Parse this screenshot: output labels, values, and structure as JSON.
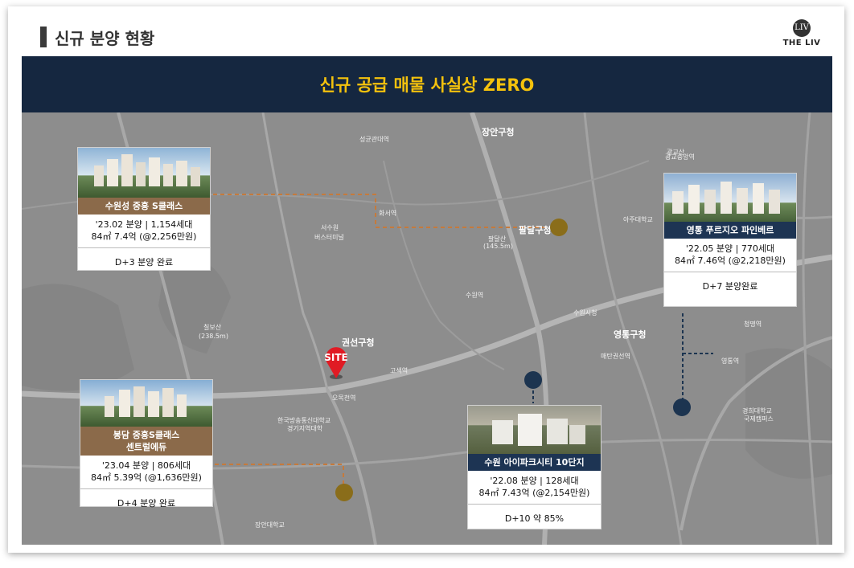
{
  "header": {
    "title": "신규 분양 현황",
    "logo_text": "THE LIV",
    "logo_mark": "LIV"
  },
  "banner": {
    "text": "신규 공급 매물 사실상 ZERO"
  },
  "site": {
    "label": "SITE"
  },
  "colors": {
    "navy": "#152740",
    "gold": "#f4c20d",
    "brown": "#8b6a4a",
    "map": "#8d8d8d"
  },
  "map_labels": {
    "jangan": "장안구청",
    "gwonseon": "권선구청",
    "yeongtong": "영통구청",
    "paldal": "팔달구청",
    "suwon_station": "수원역",
    "chilbosan": "칠보산",
    "chilbosan_h": "(238.5m)",
    "paldalsan": "팔달산",
    "paldalsan_h": "(145.5m)",
    "gwanggyo": "광교산",
    "suwon_bus": "서수원",
    "bus_terminal": "버스터미널",
    "suwon_city": "수원시청",
    "maetan": "매탄권선역",
    "gosaek": "고색역",
    "omokcheon": "오목천역",
    "hanguk": "한국방송통신대학교",
    "gyeonggi": "경기지역대학",
    "janganuniv": "장안대학교",
    "kyunghee": "경희대학교",
    "kyunghee2": "국제캠퍼스",
    "yeongtong_st": "영통역",
    "cheongmyeong": "청명역",
    "hwaseo": "화서역",
    "seongdae": "성균관대역",
    "gwanggyo_st": "광교중앙역",
    "ajoo": "아주대학교"
  },
  "cards": [
    {
      "name": "수원성 중흥 S클래스",
      "info1": "'23.02 분양 | 1,154세대",
      "info2": "84㎡ 7.4억 (@2,256만원)",
      "status": "D+3 분양 완료"
    },
    {
      "name1": "봉담 중흥S클래스",
      "name2": "센트럴에듀",
      "info1": "'23.04 분양 | 806세대",
      "info2": "84㎡ 5.39억 (@1,636만원)",
      "status": "D+4 분양 완료"
    },
    {
      "name": "수원 아이파크시티 10단지",
      "info1": "'22.08 분양 | 128세대",
      "info2": "84㎡ 7.43억 (@2,154만원)",
      "status": "D+10 약 85%"
    },
    {
      "name": "영통 푸르지오 파인베르",
      "info1": "'22.05 분양 | 770세대",
      "info2": "84㎡ 7.46억 (@2,218만원)",
      "status": "D+7 분양완료"
    }
  ]
}
